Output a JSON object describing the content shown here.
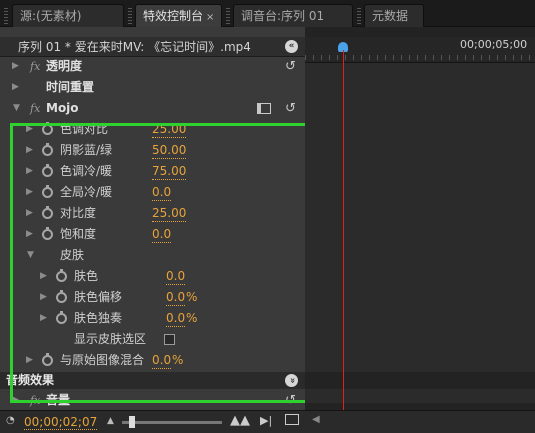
{
  "tabs": [
    {
      "label": "源:(无素材)"
    },
    {
      "label": "特效控制台",
      "close": "×"
    },
    {
      "label": "调音台:序列 01"
    },
    {
      "label": "元数据"
    }
  ],
  "header": {
    "title": "序列 01 * 爱在来时MV: 《忘记时间》.mp4",
    "collapse_glyph": "«"
  },
  "timeline": {
    "timecode": "00;00;05;00"
  },
  "effects": [
    {
      "label": "透明度"
    },
    {
      "label": "时间重置"
    }
  ],
  "mojo": {
    "label": "Mojo",
    "params": [
      {
        "label": "色调对比",
        "value": "25.00"
      },
      {
        "label": "阴影蓝/绿",
        "value": "50.00"
      },
      {
        "label": "色调冷/暖",
        "value": "75.00"
      },
      {
        "label": "全局冷/暖",
        "value": "0.0"
      },
      {
        "label": "对比度",
        "value": "25.00"
      },
      {
        "label": "饱和度",
        "value": "0.0"
      }
    ],
    "skin": {
      "label": "皮肤",
      "params": [
        {
          "label": "肤色",
          "value": "0.0",
          "unit": ""
        },
        {
          "label": "肤色偏移",
          "value": "0.0",
          "unit": "%"
        },
        {
          "label": "肤色独奏",
          "value": "0.0",
          "unit": "%"
        }
      ],
      "show_label": "显示皮肤选区"
    },
    "blend": {
      "label": "与原始图像混合",
      "value": "0.0",
      "unit": "%"
    }
  },
  "audio": {
    "header": "音频效果",
    "volume_label": "音量",
    "collapse_glyph": "»"
  },
  "bottom": {
    "timecode": "00;00;02;07"
  },
  "colors": {
    "accent": "#e8a33a",
    "selection": "#2fd12f",
    "playhead": "#dd2222"
  }
}
